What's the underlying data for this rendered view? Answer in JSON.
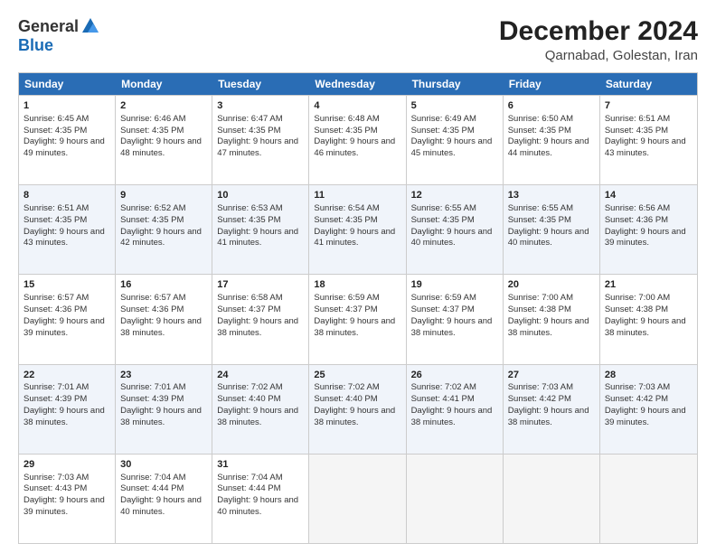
{
  "logo": {
    "general": "General",
    "blue": "Blue"
  },
  "title": "December 2024",
  "subtitle": "Qarnabad, Golestan, Iran",
  "days": [
    "Sunday",
    "Monday",
    "Tuesday",
    "Wednesday",
    "Thursday",
    "Friday",
    "Saturday"
  ],
  "weeks": [
    [
      {
        "num": "1",
        "sunrise": "6:45 AM",
        "sunset": "4:35 PM",
        "daylight": "9 hours and 49 minutes."
      },
      {
        "num": "2",
        "sunrise": "6:46 AM",
        "sunset": "4:35 PM",
        "daylight": "9 hours and 48 minutes."
      },
      {
        "num": "3",
        "sunrise": "6:47 AM",
        "sunset": "4:35 PM",
        "daylight": "9 hours and 47 minutes."
      },
      {
        "num": "4",
        "sunrise": "6:48 AM",
        "sunset": "4:35 PM",
        "daylight": "9 hours and 46 minutes."
      },
      {
        "num": "5",
        "sunrise": "6:49 AM",
        "sunset": "4:35 PM",
        "daylight": "9 hours and 45 minutes."
      },
      {
        "num": "6",
        "sunrise": "6:50 AM",
        "sunset": "4:35 PM",
        "daylight": "9 hours and 44 minutes."
      },
      {
        "num": "7",
        "sunrise": "6:51 AM",
        "sunset": "4:35 PM",
        "daylight": "9 hours and 43 minutes."
      }
    ],
    [
      {
        "num": "8",
        "sunrise": "6:51 AM",
        "sunset": "4:35 PM",
        "daylight": "9 hours and 43 minutes."
      },
      {
        "num": "9",
        "sunrise": "6:52 AM",
        "sunset": "4:35 PM",
        "daylight": "9 hours and 42 minutes."
      },
      {
        "num": "10",
        "sunrise": "6:53 AM",
        "sunset": "4:35 PM",
        "daylight": "9 hours and 41 minutes."
      },
      {
        "num": "11",
        "sunrise": "6:54 AM",
        "sunset": "4:35 PM",
        "daylight": "9 hours and 41 minutes."
      },
      {
        "num": "12",
        "sunrise": "6:55 AM",
        "sunset": "4:35 PM",
        "daylight": "9 hours and 40 minutes."
      },
      {
        "num": "13",
        "sunrise": "6:55 AM",
        "sunset": "4:35 PM",
        "daylight": "9 hours and 40 minutes."
      },
      {
        "num": "14",
        "sunrise": "6:56 AM",
        "sunset": "4:36 PM",
        "daylight": "9 hours and 39 minutes."
      }
    ],
    [
      {
        "num": "15",
        "sunrise": "6:57 AM",
        "sunset": "4:36 PM",
        "daylight": "9 hours and 39 minutes."
      },
      {
        "num": "16",
        "sunrise": "6:57 AM",
        "sunset": "4:36 PM",
        "daylight": "9 hours and 38 minutes."
      },
      {
        "num": "17",
        "sunrise": "6:58 AM",
        "sunset": "4:37 PM",
        "daylight": "9 hours and 38 minutes."
      },
      {
        "num": "18",
        "sunrise": "6:59 AM",
        "sunset": "4:37 PM",
        "daylight": "9 hours and 38 minutes."
      },
      {
        "num": "19",
        "sunrise": "6:59 AM",
        "sunset": "4:37 PM",
        "daylight": "9 hours and 38 minutes."
      },
      {
        "num": "20",
        "sunrise": "7:00 AM",
        "sunset": "4:38 PM",
        "daylight": "9 hours and 38 minutes."
      },
      {
        "num": "21",
        "sunrise": "7:00 AM",
        "sunset": "4:38 PM",
        "daylight": "9 hours and 38 minutes."
      }
    ],
    [
      {
        "num": "22",
        "sunrise": "7:01 AM",
        "sunset": "4:39 PM",
        "daylight": "9 hours and 38 minutes."
      },
      {
        "num": "23",
        "sunrise": "7:01 AM",
        "sunset": "4:39 PM",
        "daylight": "9 hours and 38 minutes."
      },
      {
        "num": "24",
        "sunrise": "7:02 AM",
        "sunset": "4:40 PM",
        "daylight": "9 hours and 38 minutes."
      },
      {
        "num": "25",
        "sunrise": "7:02 AM",
        "sunset": "4:40 PM",
        "daylight": "9 hours and 38 minutes."
      },
      {
        "num": "26",
        "sunrise": "7:02 AM",
        "sunset": "4:41 PM",
        "daylight": "9 hours and 38 minutes."
      },
      {
        "num": "27",
        "sunrise": "7:03 AM",
        "sunset": "4:42 PM",
        "daylight": "9 hours and 38 minutes."
      },
      {
        "num": "28",
        "sunrise": "7:03 AM",
        "sunset": "4:42 PM",
        "daylight": "9 hours and 39 minutes."
      }
    ],
    [
      {
        "num": "29",
        "sunrise": "7:03 AM",
        "sunset": "4:43 PM",
        "daylight": "9 hours and 39 minutes."
      },
      {
        "num": "30",
        "sunrise": "7:04 AM",
        "sunset": "4:44 PM",
        "daylight": "9 hours and 40 minutes."
      },
      {
        "num": "31",
        "sunrise": "7:04 AM",
        "sunset": "4:44 PM",
        "daylight": "9 hours and 40 minutes."
      },
      null,
      null,
      null,
      null
    ]
  ]
}
